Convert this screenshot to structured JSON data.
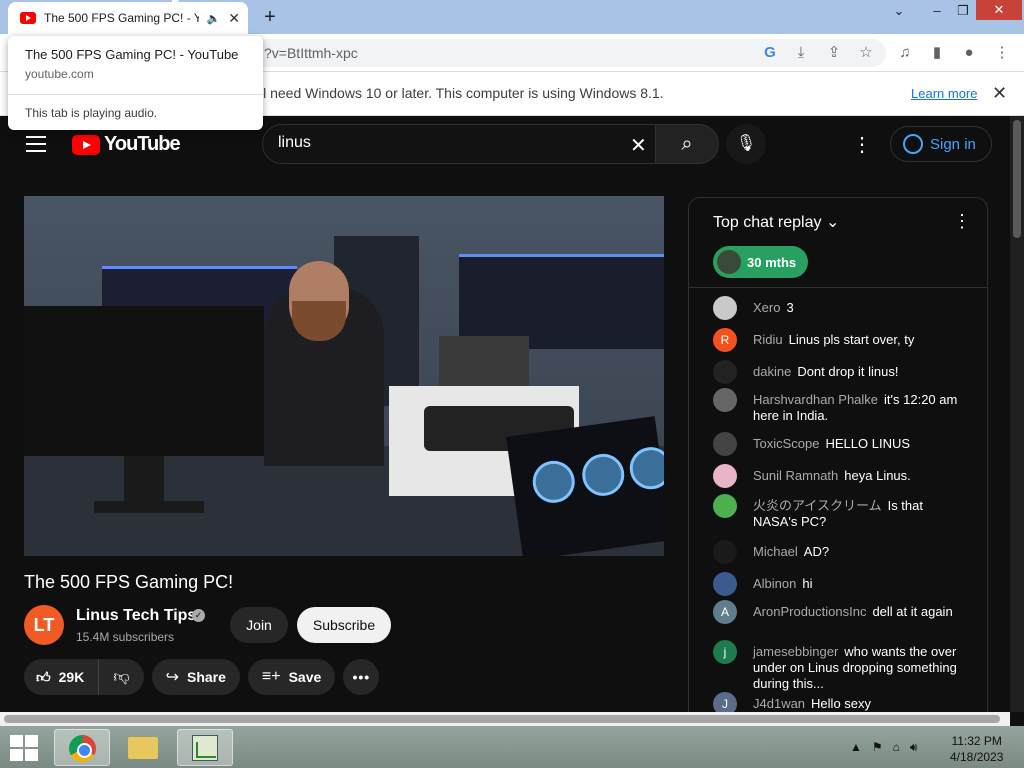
{
  "browser": {
    "tab_title": "The 500 FPS Gaming PC! - YouTube",
    "url_fragment": "?v=BtIttmh-xpc",
    "popup": {
      "title": "The 500 FPS Gaming PC! - YouTube",
      "domain": "youtube.com",
      "audio_status": "This tab is playing audio."
    },
    "infobar": {
      "text": "ll need Windows 10 or later. This computer is using Windows 8.1.",
      "link": "Learn more"
    }
  },
  "youtube": {
    "logo": "YouTube",
    "search_value": "linus",
    "signin_label": "Sign in",
    "video_title": "The 500 FPS Gaming PC!",
    "channel": {
      "name": "Linus Tech Tips",
      "subscribers": "15.4M subscribers",
      "join_label": "Join",
      "subscribe_label": "Subscribe"
    },
    "actions": {
      "likes": "29K",
      "share": "Share",
      "save": "Save"
    },
    "chat": {
      "title": "Top chat replay",
      "chip": "30 mths",
      "messages": [
        {
          "author": "Xero",
          "text": "3",
          "avatar_letter": "",
          "avatar_color": "#c9c9c9"
        },
        {
          "author": "Ridiu",
          "text": "Linus pls start over, ty",
          "avatar_letter": "R",
          "avatar_color": "#f4511e"
        },
        {
          "author": "dakine",
          "text": "Dont drop it linus!",
          "avatar_letter": "",
          "avatar_color": "#222222"
        },
        {
          "author": "Harshvardhan Phalke",
          "text": "it's 12:20 am here in India.",
          "avatar_letter": "",
          "avatar_color": "#666666"
        },
        {
          "author": "ToxicScope",
          "text": "HELLO LINUS",
          "avatar_letter": "",
          "avatar_color": "#444444"
        },
        {
          "author": "Sunil Ramnath",
          "text": "heya Linus.",
          "avatar_letter": "",
          "avatar_color": "#e8b4c8"
        },
        {
          "author": "火炎のアイスクリーム",
          "text": "Is that NASA's PC?",
          "avatar_letter": "",
          "avatar_color": "#4caf50"
        },
        {
          "author": "Michael",
          "text": "AD?",
          "avatar_letter": "",
          "avatar_color": "#1a1a1a"
        },
        {
          "author": "Albinon",
          "text": "hi",
          "avatar_letter": "",
          "avatar_color": "#3b5b8f"
        },
        {
          "author": "AronProductionsInc",
          "text": "dell at it again",
          "avatar_letter": "A",
          "avatar_color": "#607d8b"
        },
        {
          "author": "jamesebbinger",
          "text": "who wants the over under on Linus dropping something during this...",
          "avatar_letter": "j",
          "avatar_color": "#1e7b4e"
        },
        {
          "author": "J4d1wan",
          "text": "Hello sexy",
          "avatar_letter": "J",
          "avatar_color": "#5c6b8a"
        }
      ]
    }
  },
  "taskbar": {
    "time": "11:32 PM",
    "date": "4/18/2023"
  },
  "colors": {
    "yt_red": "#ff0000",
    "link_blue": "#3ea6ff",
    "chip_green": "#28a060"
  }
}
